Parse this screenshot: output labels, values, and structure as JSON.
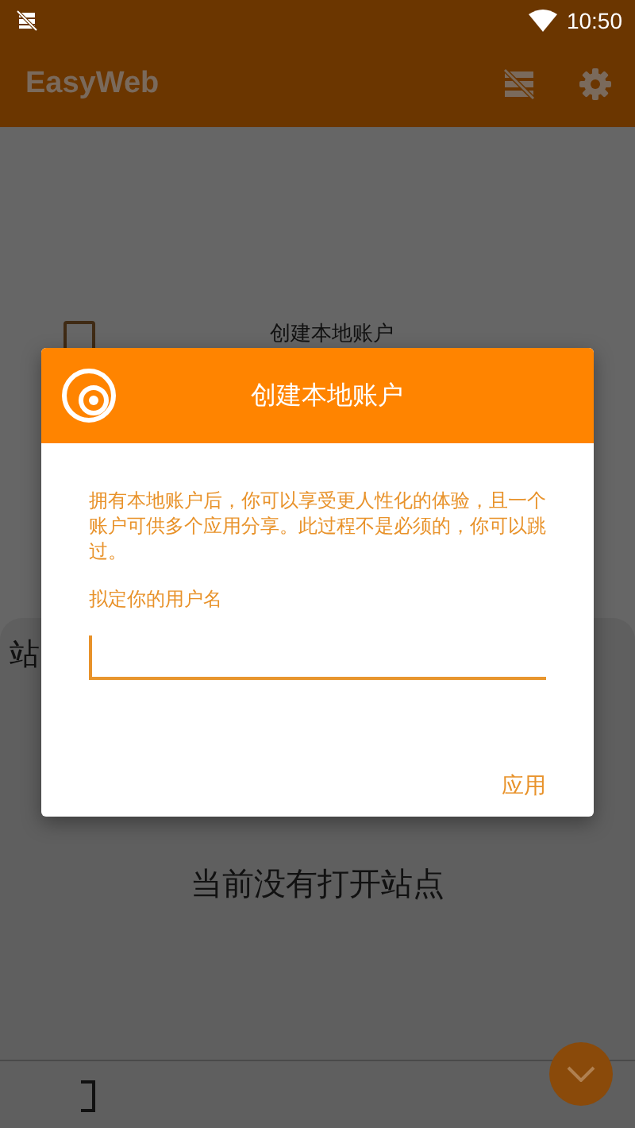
{
  "status_bar": {
    "time": "10:50"
  },
  "app_bar": {
    "title": "EasyWeb"
  },
  "background": {
    "option": {
      "label": "创建本地账户",
      "checked": false
    },
    "sheet": {
      "title": "站"
    },
    "empty_message": "当前没有打开站点"
  },
  "dialog": {
    "title": "创建本地账户",
    "message": "拥有本地账户后，你可以享受更人性化的体验，且一个账户可供多个应用分享。此过程不是必须的，你可以跳过。",
    "field_label": "拟定你的用户名",
    "buttons": [
      {
        "label": "应用",
        "kind": "text"
      }
    ]
  }
}
